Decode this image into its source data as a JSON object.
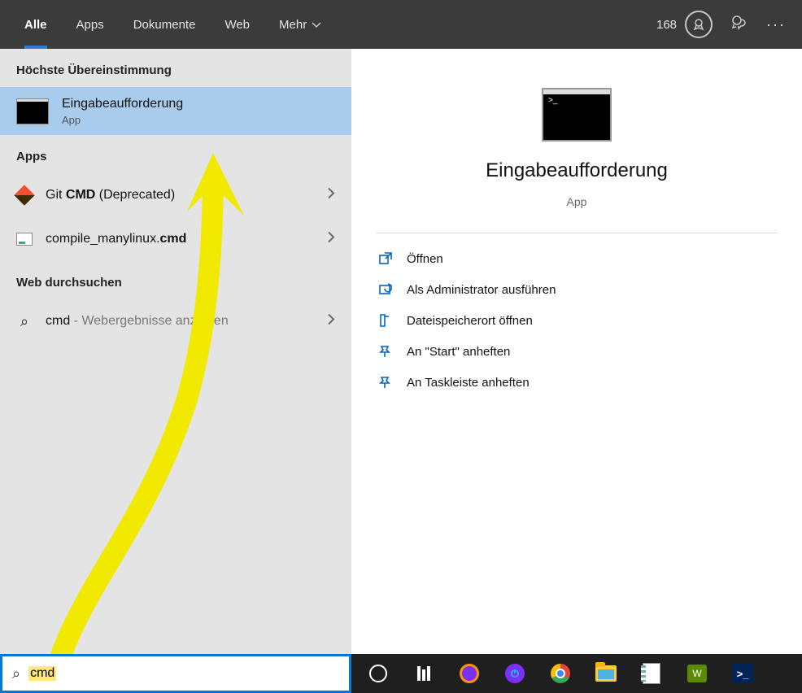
{
  "tabs": {
    "all": "Alle",
    "apps": "Apps",
    "docs": "Dokumente",
    "web": "Web",
    "more": "Mehr"
  },
  "points": "168",
  "sections": {
    "best_match": "Höchste Übereinstimmung",
    "apps": "Apps",
    "web_search": "Web durchsuchen"
  },
  "best_match": {
    "title": "Eingabeaufforderung",
    "subtitle": "App"
  },
  "app_results": [
    {
      "pre": "Git ",
      "match": "CMD",
      "post": " (Deprecated)"
    },
    {
      "pre": "compile_manylinux.",
      "match": "cmd",
      "post": ""
    }
  ],
  "web_result": {
    "query": "cmd",
    "hint": " - Webergebnisse anzeigen"
  },
  "preview": {
    "title": "Eingabeaufforderung",
    "subtitle": "App"
  },
  "actions": {
    "open": "Öffnen",
    "admin": "Als Administrator ausführen",
    "location": "Dateispeicherort öffnen",
    "pin_start": "An \"Start\" anheften",
    "pin_taskbar": "An Taskleiste anheften"
  },
  "search": {
    "value": "cmd"
  }
}
